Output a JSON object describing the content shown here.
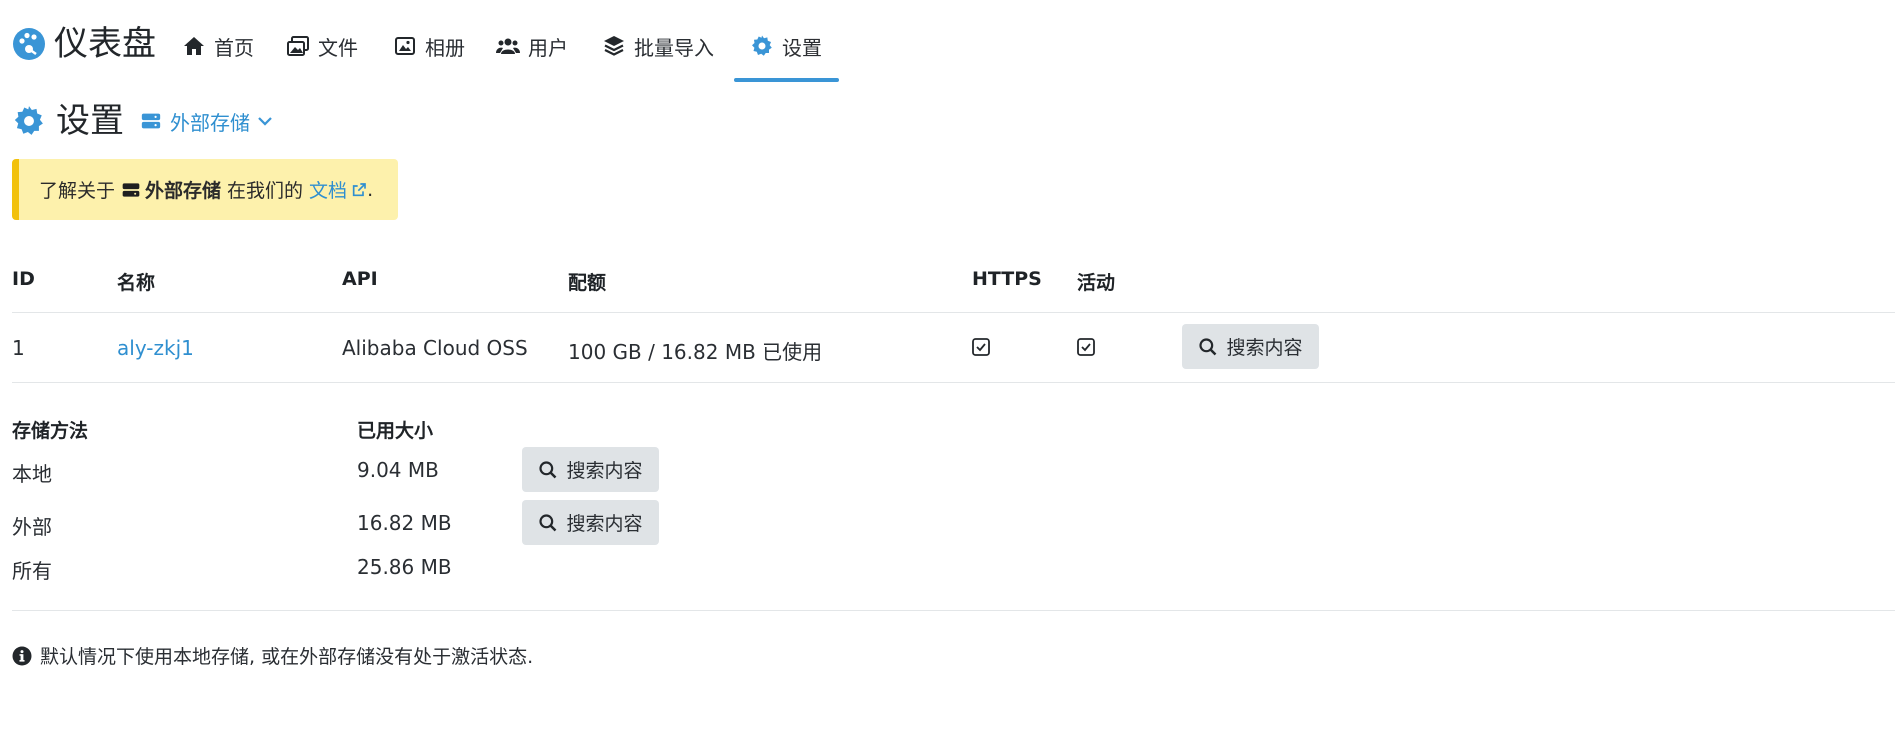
{
  "brand": {
    "title": "仪表盘",
    "accent": "#3a95d6"
  },
  "nav": {
    "items": [
      {
        "label": "首页",
        "icon": "home-icon"
      },
      {
        "label": "文件",
        "icon": "images-icon"
      },
      {
        "label": "相册",
        "icon": "album-icon"
      },
      {
        "label": "用户",
        "icon": "users-icon"
      },
      {
        "label": "批量导入",
        "icon": "layers-icon"
      },
      {
        "label": "设置",
        "icon": "gear-icon",
        "active": true
      }
    ]
  },
  "header": {
    "title": "设置",
    "storage_selector": "外部存储"
  },
  "notice": {
    "prefix": "了解关于",
    "bold": "外部存储",
    "middle": "在我们的",
    "link": "文档",
    "suffix": "."
  },
  "table": {
    "columns": [
      "ID",
      "名称",
      "API",
      "配额",
      "HTTPS",
      "活动"
    ],
    "rows": [
      {
        "id": "1",
        "name": "aly-zkj1",
        "api": "Alibaba Cloud OSS",
        "quota": "100 GB / 16.82 MB 已使用",
        "https": true,
        "active": true,
        "action": "搜索内容"
      }
    ]
  },
  "usage": {
    "columns": [
      "存储方法",
      "已用大小"
    ],
    "rows": [
      {
        "method": "本地",
        "size": "9.04 MB",
        "action": "搜索内容"
      },
      {
        "method": "外部",
        "size": "16.82 MB",
        "action": "搜索内容"
      },
      {
        "method": "所有",
        "size": "25.86 MB"
      }
    ]
  },
  "footer": {
    "info": "默认情况下使用本地存储, 或在外部存储没有处于激活状态."
  }
}
